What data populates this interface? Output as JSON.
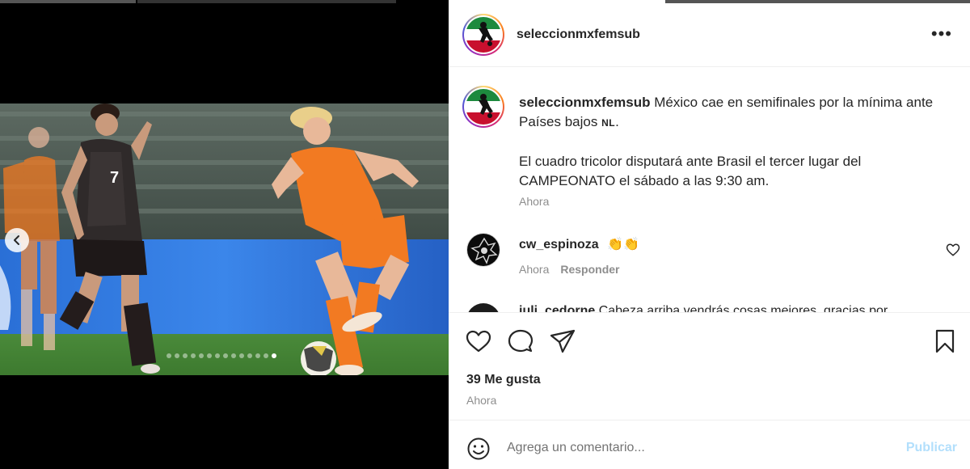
{
  "post": {
    "username": "seleccionmxfemsub",
    "more_icon": "more-horizontal-icon",
    "caption_text": "México cae en semifinales por la mínima ante Países bajos",
    "caption_flag": "NL",
    "caption_text_2": "El cuadro tricolor disputará ante Brasil el tercer lugar del CAMPEONATO el sábado a las 9:30 am.",
    "caption_time": "Ahora"
  },
  "media": {
    "jersey_number": "7",
    "carousel_total": 14,
    "carousel_active": 13,
    "prev_icon": "chevron-left-icon"
  },
  "comments": [
    {
      "username": "cw_espinoza",
      "text": "👏👏",
      "time": "Ahora",
      "reply_label": "Responder"
    },
    {
      "username": "juli_cedorne",
      "text": "Cabeza arriba vendrás cosas mejores, gracias por"
    }
  ],
  "actions": {
    "like_icon": "heart-icon",
    "comment_icon": "comment-icon",
    "share_icon": "share-icon",
    "save_icon": "bookmark-icon"
  },
  "likes_text": "39 Me gusta",
  "post_time": "Ahora",
  "composer": {
    "placeholder": "Agrega un comentario...",
    "post_label": "Publicar",
    "emoji_icon": "emoji-icon"
  },
  "colors": {
    "mexico_green": "#1d8a3e",
    "mexico_red": "#c8102e",
    "netherlands_orange": "#f27a22",
    "publish_disabled": "#b2dffc",
    "secondary_text": "#8e8e8e"
  }
}
